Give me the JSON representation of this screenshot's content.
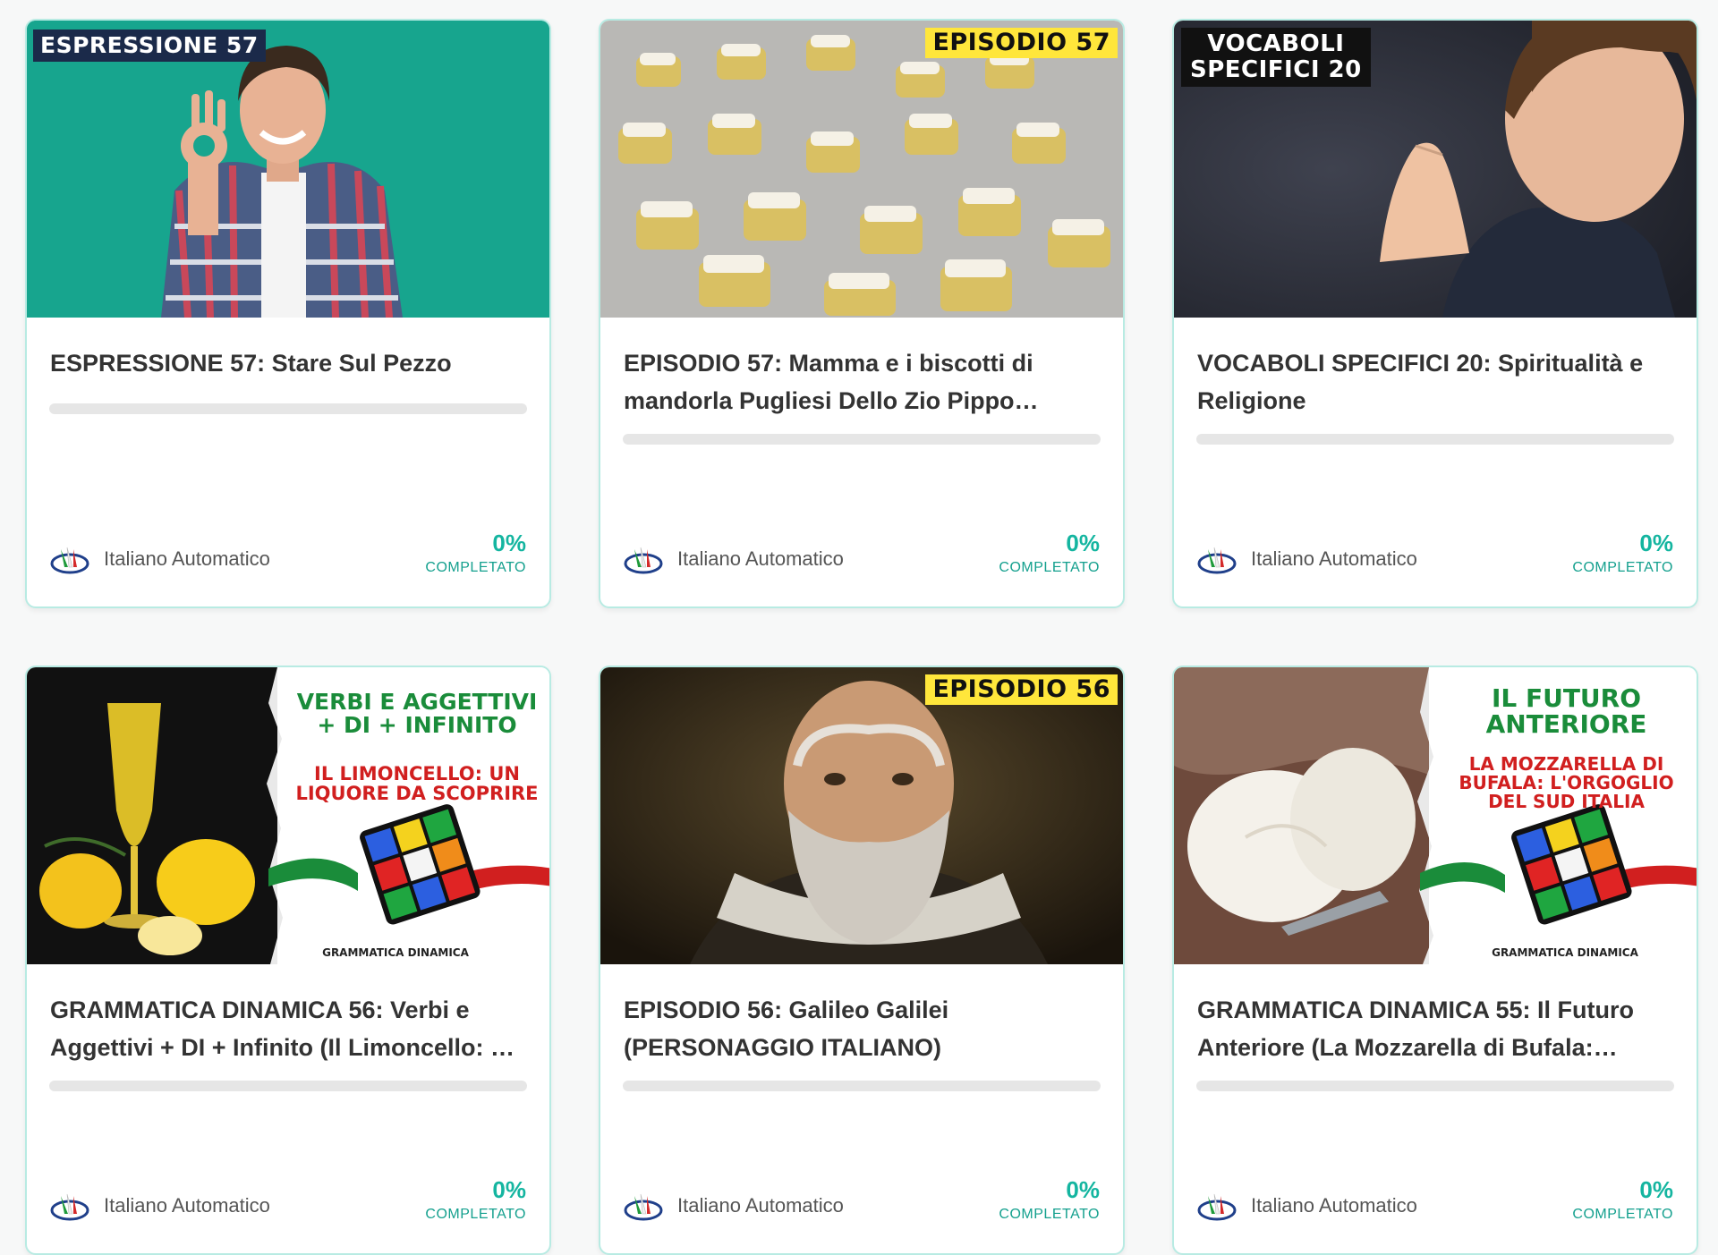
{
  "courses": [
    {
      "thumb_tag": "ESPRESSIONE 57",
      "title": "ESPRESSIONE 57: Stare Sul Pezzo",
      "author": "Italiano Automatico",
      "progress_value": "0%",
      "progress_label": "COMPLETATO",
      "progress_fraction": 0
    },
    {
      "thumb_tag": "EPISODIO 57",
      "title": "EPISODIO 57: Mamma e i biscotti di mandorla Pugliesi Dello Zio Pippo…",
      "author": "Italiano Automatico",
      "progress_value": "0%",
      "progress_label": "COMPLETATO",
      "progress_fraction": 0
    },
    {
      "thumb_tag": "VOCABOLI\nSPECIFICI 20",
      "title": "VOCABOLI SPECIFICI 20: Spiritualità e Religione",
      "author": "Italiano Automatico",
      "progress_value": "0%",
      "progress_label": "COMPLETATO",
      "progress_fraction": 0
    },
    {
      "thumb_title": "VERBI E AGGETTIVI\n+ DI + INFINITO",
      "thumb_subtitle": "IL LIMONCELLO: UN\nLIQUORE DA SCOPRIRE",
      "thumb_footer": "GRAMMATICA DINAMICA",
      "title": "GRAMMATICA DINAMICA 56: Verbi e Aggettivi + DI + Infinito (Il Limoncello: …",
      "author": "Italiano Automatico",
      "progress_value": "0%",
      "progress_label": "COMPLETATO",
      "progress_fraction": 0
    },
    {
      "thumb_tag": "EPISODIO 56",
      "title": "EPISODIO 56: Galileo Galilei (PERSONAGGIO ITALIANO)",
      "author": "Italiano Automatico",
      "progress_value": "0%",
      "progress_label": "COMPLETATO",
      "progress_fraction": 0
    },
    {
      "thumb_title": "IL FUTURO\nANTERIORE",
      "thumb_subtitle": "LA MOZZARELLA DI\nBUFALA: L'ORGOGLIO\nDEL SUD ITALIA",
      "thumb_footer": "GRAMMATICA DINAMICA",
      "title": "GRAMMATICA DINAMICA 55: Il Futuro Anteriore (La Mozzarella di Bufala:…",
      "author": "Italiano Automatico",
      "progress_value": "0%",
      "progress_label": "COMPLETATO",
      "progress_fraction": 0
    }
  ],
  "colors": {
    "accent": "#14b5a0",
    "card_border": "#b8ebe3",
    "progress_track": "#e6e6e6",
    "tag_yellow": "#ffe63b",
    "poster_green": "#1a8c3a",
    "poster_red": "#d11f1f"
  },
  "icons": {
    "author_logo": "italiano-automatico-logo-icon"
  }
}
